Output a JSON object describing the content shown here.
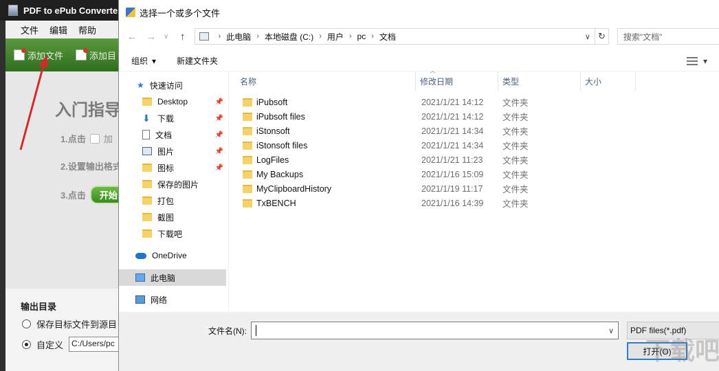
{
  "app": {
    "title": "PDF to ePub Converte",
    "menu": [
      "文件",
      "编辑",
      "帮助"
    ],
    "toolbar": {
      "add_file": "添加文件",
      "add_folder": "添加目"
    },
    "guide": {
      "title": "入门指导",
      "step1": "1.点击",
      "step1_ghost": "加",
      "step2": "2.设置输出格式",
      "step3": "3.点击",
      "start_label": "开始"
    },
    "output": {
      "label": "输出目录",
      "option1": "保存目标文件到源目",
      "option2": "自定义",
      "path_value": "C:/Users/pc"
    }
  },
  "dialog": {
    "title": "选择一个或多个文件",
    "breadcrumbs": [
      "此电脑",
      "本地磁盘 (C:)",
      "用户",
      "pc",
      "文档"
    ],
    "search_placeholder": "搜索\"文档\"",
    "organize": "组织",
    "new_folder": "新建文件夹",
    "nav": {
      "quick_access": "快速访问",
      "items": [
        "Desktop",
        "下载",
        "文档",
        "图片",
        "图标",
        "保存的图片",
        "打包",
        "截图",
        "下载吧"
      ],
      "onedrive": "OneDrive",
      "this_pc": "此电脑",
      "network": "网络"
    },
    "columns": {
      "name": "名称",
      "date": "修改日期",
      "type": "类型",
      "size": "大小"
    },
    "files": [
      {
        "name": "iPubsoft",
        "date": "2021/1/21 14:12",
        "type": "文件夹"
      },
      {
        "name": "iPubsoft files",
        "date": "2021/1/21 14:12",
        "type": "文件夹"
      },
      {
        "name": "iStonsoft",
        "date": "2021/1/21 14:34",
        "type": "文件夹"
      },
      {
        "name": "iStonsoft files",
        "date": "2021/1/21 14:34",
        "type": "文件夹"
      },
      {
        "name": "LogFiles",
        "date": "2021/1/21 11:23",
        "type": "文件夹"
      },
      {
        "name": "My Backups",
        "date": "2021/1/16 15:09",
        "type": "文件夹"
      },
      {
        "name": "MyClipboardHistory",
        "date": "2021/1/19 11:17",
        "type": "文件夹"
      },
      {
        "name": "TxBENCH",
        "date": "2021/1/16 14:39",
        "type": "文件夹"
      }
    ],
    "filename_label": "文件名(N):",
    "filename_value": "",
    "filter": "PDF files(*.pdf)",
    "open_button": "打开(O)"
  },
  "watermark": "下载吧"
}
